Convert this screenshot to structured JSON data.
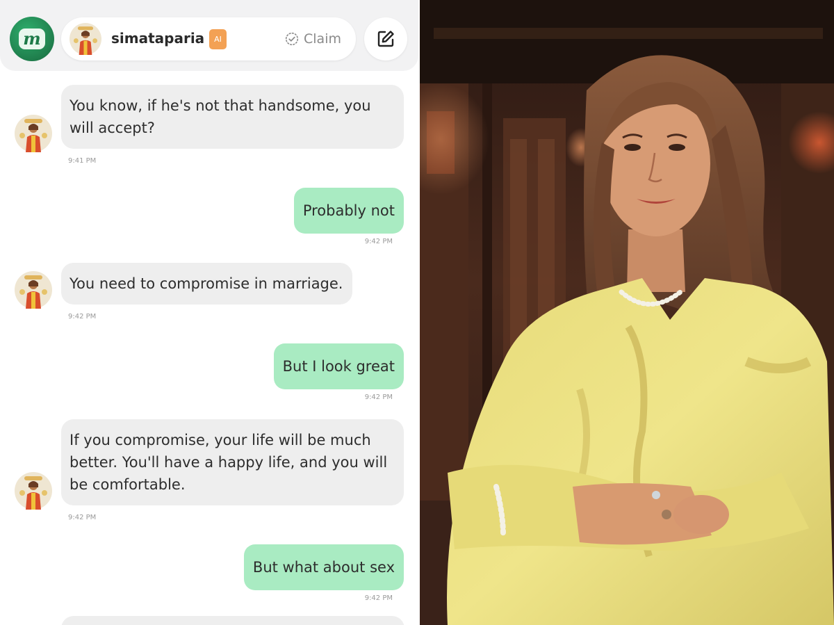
{
  "header": {
    "logo_letter": "m",
    "username": "simataparia",
    "ai_badge": "AI",
    "claim_label": "Claim",
    "claim_icon": "check-circle-icon",
    "edit_icon": "edit-icon"
  },
  "messages": [
    {
      "sender": "bot",
      "text": "You know, if he's not that handsome, you will accept?",
      "time": "9:41 PM"
    },
    {
      "sender": "user",
      "text": "Probably not",
      "time": "9:42 PM"
    },
    {
      "sender": "bot",
      "text": "You need to compromise in marriage.",
      "time": "9:42 PM"
    },
    {
      "sender": "user",
      "text": "But I look great",
      "time": "9:42 PM"
    },
    {
      "sender": "bot",
      "text": "If you compromise, your life will be much better. You'll have a happy life, and you will be comfortable.",
      "time": "9:42 PM"
    },
    {
      "sender": "user",
      "text": "But what about sex",
      "time": "9:42 PM"
    }
  ],
  "colors": {
    "brand_green": "#1f7e4c",
    "incoming_bubble": "#eeeeee",
    "outgoing_bubble": "#a9ebc2",
    "ai_badge": "#f3a154",
    "topbar_bg": "#f2f2f3"
  }
}
